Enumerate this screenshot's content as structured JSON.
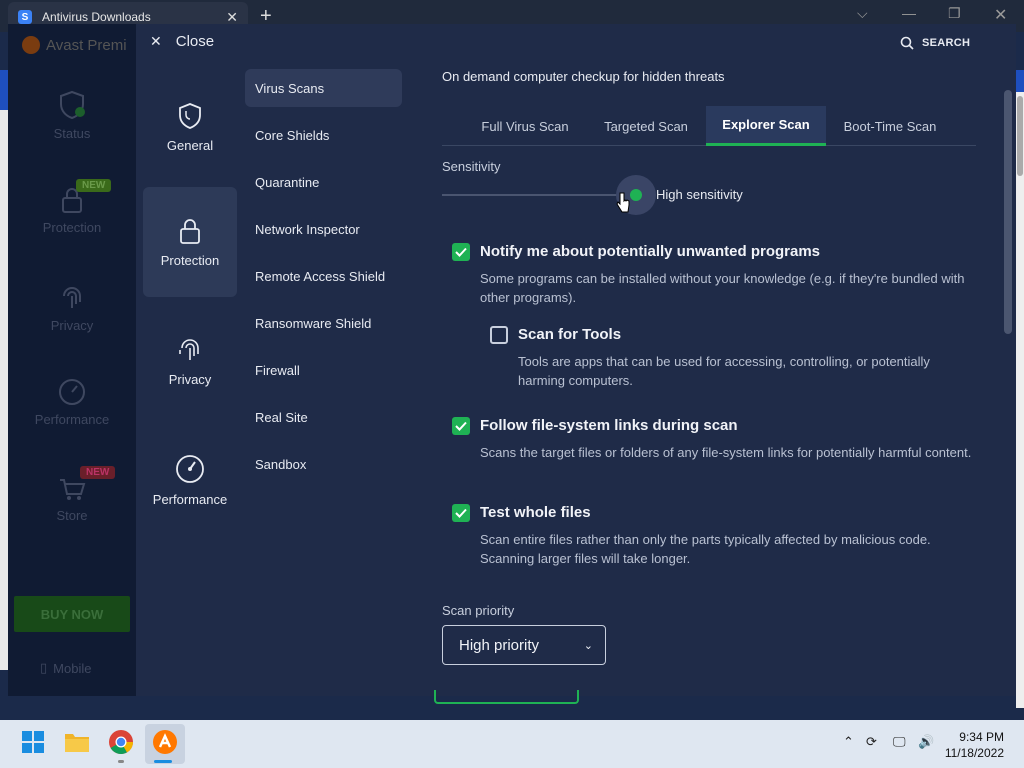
{
  "browser": {
    "tab_title": "Antivirus Downloads",
    "favicon_letter": "S"
  },
  "main_window": {
    "title": "Avast Premi",
    "nav": [
      {
        "label": "Status"
      },
      {
        "label": "Protection",
        "badge": "NEW"
      },
      {
        "label": "Privacy"
      },
      {
        "label": "Performance"
      },
      {
        "label": "Store",
        "badge": "NEW"
      }
    ],
    "buy_now": "BUY NOW",
    "mobile": "Mobile"
  },
  "settings": {
    "close_label": "Close",
    "search_label": "SEARCH",
    "categories": [
      {
        "label": "General"
      },
      {
        "label": "Protection"
      },
      {
        "label": "Privacy"
      },
      {
        "label": "Performance"
      }
    ],
    "sub_nav": [
      {
        "label": "Virus Scans"
      },
      {
        "label": "Core Shields"
      },
      {
        "label": "Quarantine"
      },
      {
        "label": "Network Inspector"
      },
      {
        "label": "Remote Access Shield"
      },
      {
        "label": "Ransomware Shield"
      },
      {
        "label": "Firewall"
      },
      {
        "label": "Real Site"
      },
      {
        "label": "Sandbox"
      }
    ],
    "heading": "On demand computer checkup for hidden threats",
    "tabs": [
      {
        "label": "Full Virus Scan"
      },
      {
        "label": "Targeted Scan"
      },
      {
        "label": "Explorer Scan"
      },
      {
        "label": "Boot-Time Scan"
      }
    ],
    "active_tab": "Explorer Scan",
    "sensitivity": {
      "label": "Sensitivity",
      "value_label": "High sensitivity"
    },
    "options": [
      {
        "title": "Notify me about potentially unwanted programs",
        "desc": "Some programs can be installed without your knowledge (e.g. if they're bundled with other programs).",
        "checked": true
      },
      {
        "title": "Scan for Tools",
        "desc": "Tools are apps that can be used for accessing, controlling, or potentially harming computers.",
        "checked": false
      },
      {
        "title": "Follow file-system links during scan",
        "desc": "Scans the target files or folders of any file-system links for potentially harmful content.",
        "checked": true
      },
      {
        "title": "Test whole files",
        "desc": "Scan entire files rather than only the parts typically affected by malicious code. Scanning larger files will take longer.",
        "checked": true
      }
    ],
    "priority": {
      "label": "Scan priority",
      "value": "High priority"
    }
  },
  "taskbar": {
    "time": "9:34 PM",
    "date": "11/18/2022"
  },
  "colors": {
    "accent_green": "#1fb254",
    "panel_bg": "#1f2b48",
    "sidebar_bg": "#101b33"
  }
}
